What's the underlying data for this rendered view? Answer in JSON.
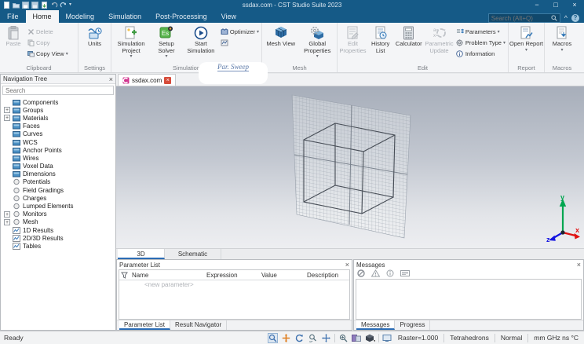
{
  "window": {
    "title": "ssdax.com - CST Studio Suite 2023",
    "min": "−",
    "max": "□",
    "close": "×"
  },
  "glyphs": {
    "caret": "▾",
    "plus": "+",
    "close": "×",
    "up": "^",
    "help": "?"
  },
  "tabs": {
    "file": "File",
    "home": "Home",
    "modeling": "Modeling",
    "simulation": "Simulation",
    "post": "Post-Processing",
    "view": "View"
  },
  "search": {
    "placeholder": "Search (Alt+Q)"
  },
  "ribbon": {
    "clipboard": {
      "label": "Clipboard",
      "paste": "Paste",
      "del": "Delete",
      "copy": "Copy",
      "copy_view": "Copy View"
    },
    "settings": {
      "label": "Settings",
      "units": "Units"
    },
    "simulation": {
      "label": "Simulation",
      "project": "Simulation Project",
      "solver": "Setup Solver",
      "start": "Start Simulation",
      "optimizer": "Optimizer",
      "par_sweep": "Par. Sweep"
    },
    "mesh": {
      "label": "Mesh",
      "view": "Mesh View",
      "global": "Global Properties"
    },
    "edit": {
      "label": "Edit",
      "props": "Edit Properties",
      "history": "History List",
      "calc": "Calculator",
      "param_update": "Parametric Update",
      "parameters": "Parameters",
      "problem": "Problem Type",
      "info": "Information"
    },
    "report": {
      "label": "Report",
      "open": "Open Report"
    },
    "macros": {
      "label": "Macros",
      "btn": "Macros"
    }
  },
  "nav": {
    "title": "Navigation Tree",
    "search_placeholder": "Search",
    "items": [
      {
        "label": "Components"
      },
      {
        "label": "Groups"
      },
      {
        "label": "Materials"
      },
      {
        "label": "Faces"
      },
      {
        "label": "Curves"
      },
      {
        "label": "WCS"
      },
      {
        "label": "Anchor Points"
      },
      {
        "label": "Wires"
      },
      {
        "label": "Voxel Data"
      },
      {
        "label": "Dimensions"
      },
      {
        "label": "Potentials"
      },
      {
        "label": "Field Gradings"
      },
      {
        "label": "Charges"
      },
      {
        "label": "Lumped Elements"
      },
      {
        "label": "Monitors"
      },
      {
        "label": "Mesh"
      },
      {
        "label": "1D Results"
      },
      {
        "label": "2D/3D Results"
      },
      {
        "label": "Tables"
      }
    ]
  },
  "doc": {
    "tab": "ssdax.com",
    "view_3d": "3D",
    "view_schematic": "Schematic"
  },
  "params": {
    "title": "Parameter List",
    "col_name": "Name",
    "col_expr": "Expression",
    "col_value": "Value",
    "col_desc": "Description",
    "new_row": "<new parameter>",
    "tab_list": "Parameter List",
    "tab_nav": "Result Navigator"
  },
  "msgs": {
    "title": "Messages",
    "tab_messages": "Messages",
    "tab_progress": "Progress"
  },
  "status": {
    "ready": "Ready",
    "raster": "Raster=1.000",
    "tets": "Tetrahedrons",
    "normal": "Normal",
    "units": "mm GHz ns °C"
  },
  "axes": {
    "x": "x",
    "y": "y",
    "z": "z"
  }
}
